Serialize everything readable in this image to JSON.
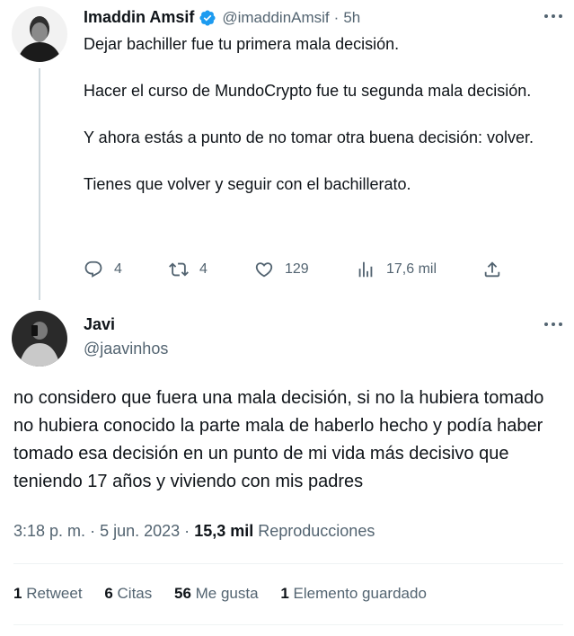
{
  "parent_tweet": {
    "author_name": "Imaddin Amsif",
    "handle": "@imaddinAmsif",
    "separator": "·",
    "time": "5h",
    "text": "Dejar bachiller fue tu primera mala decisión.\n\nHacer el curso de MundoCrypto fue tu segunda mala decisión.\n\nY ahora estás a punto de no tomar otra buena decisión: volver.\n\nTienes que volver y seguir con el bachillerato.",
    "actions": {
      "replies": "4",
      "retweets": "4",
      "likes": "129",
      "views": "17,6 mil"
    }
  },
  "reply_tweet": {
    "author_name": "Javi",
    "handle": "@jaavinhos",
    "text": "no considero que fuera una mala decisión, si no la hubiera tomado no hubiera conocido la parte mala de haberlo hecho y podía haber tomado esa decisión en un punto de mi vida más decisivo que teniendo 17 años y viviendo con mis padres",
    "time": "3:18 p. m.",
    "date": "5 jun. 2023",
    "dot": "·",
    "views_count": "15,3 mil",
    "views_label": "Reproducciones",
    "stats": {
      "retweets_count": "1",
      "retweets_label": "Retweet",
      "quotes_count": "6",
      "quotes_label": "Citas",
      "likes_count": "56",
      "likes_label": "Me gusta",
      "bookmarks_count": "1",
      "bookmarks_label": "Elemento guardado"
    }
  },
  "colors": {
    "text": "#0f1419",
    "muted": "#536471",
    "verified": "#1d9bf0",
    "divider": "#eff3f4",
    "thread_line": "#cfd9de"
  }
}
